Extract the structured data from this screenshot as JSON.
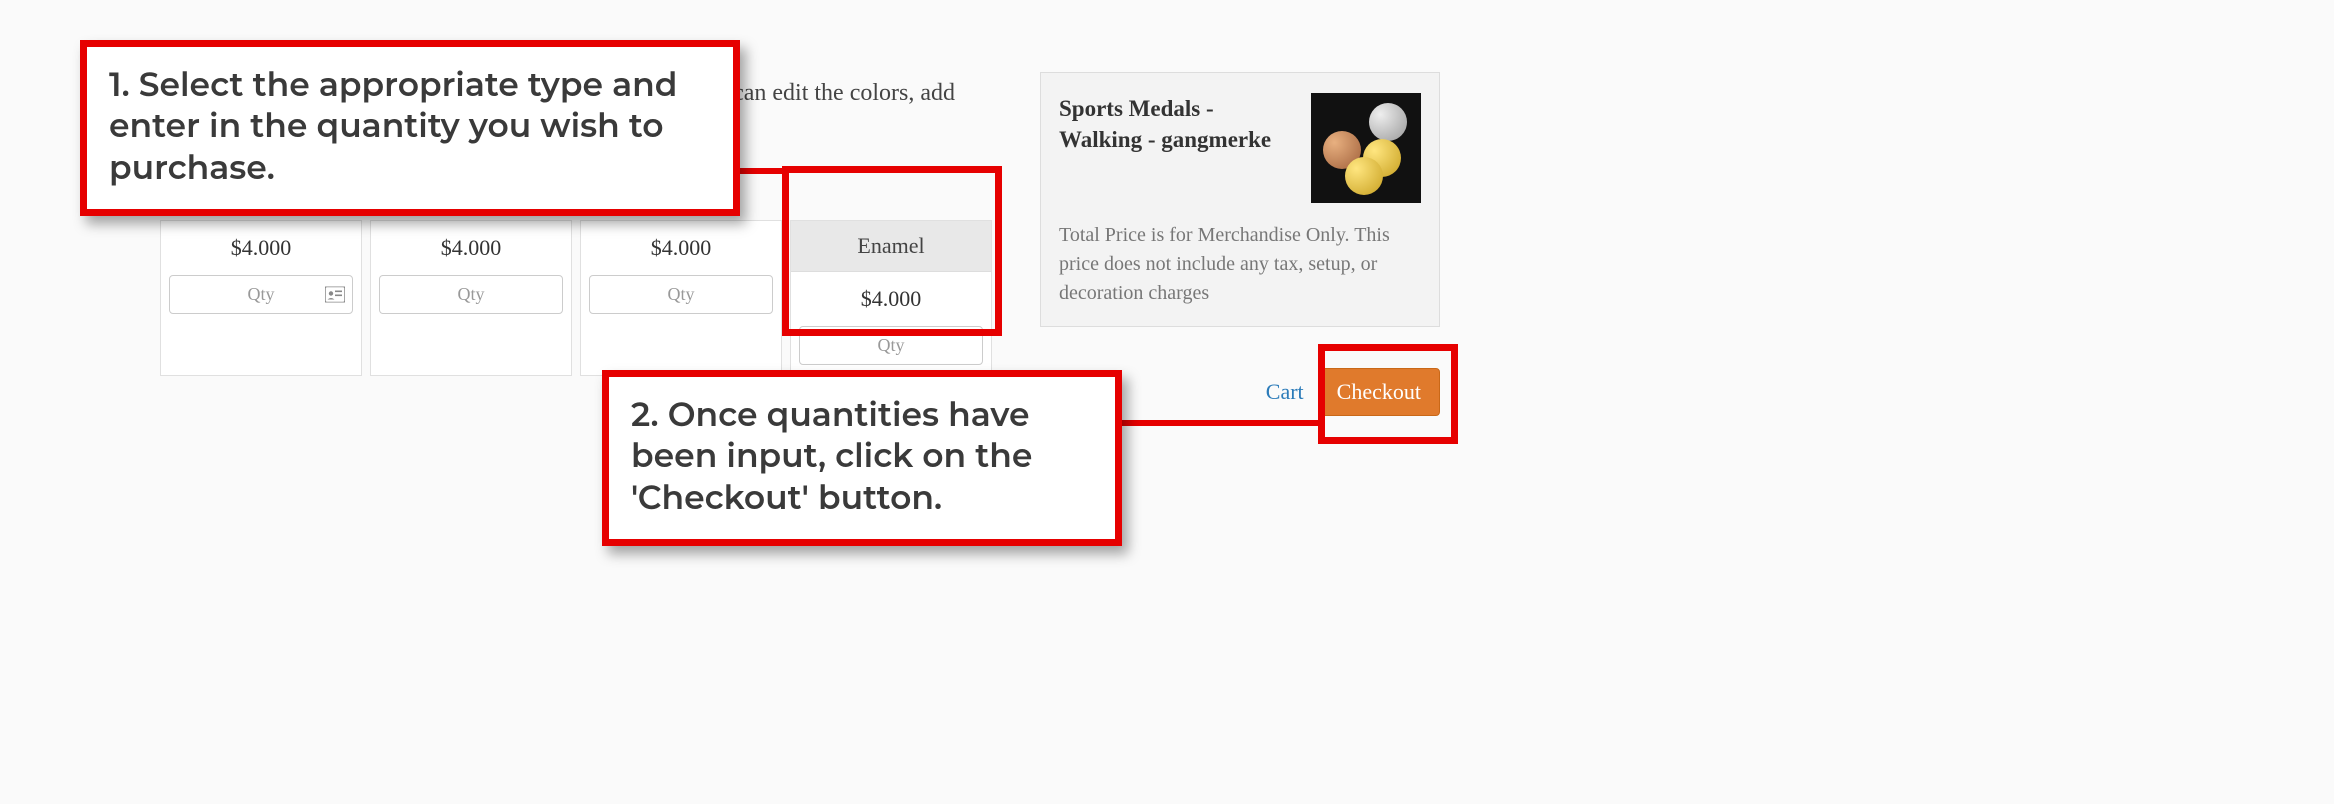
{
  "main": {
    "description_fragment": "u can edit the colors, add"
  },
  "pricing": {
    "columns": [
      {
        "header": "",
        "price": "$4.000",
        "qty_placeholder": "Qty"
      },
      {
        "header": "",
        "price": "$4.000",
        "qty_placeholder": "Qty"
      },
      {
        "header": "",
        "price": "$4.000",
        "qty_placeholder": "Qty"
      },
      {
        "header": "Enamel",
        "price": "$4.000",
        "qty_placeholder": "Qty"
      }
    ]
  },
  "sidebar": {
    "title": "Sports Medals - Walking - gangmerke",
    "disclaimer": "Total Price is for Merchandise Only. This price does not include any tax, setup, or decoration charges"
  },
  "actions": {
    "cart_link_fragment": "Cart",
    "checkout_label": "Checkout"
  },
  "callouts": {
    "step1": "1. Select the appropriate type and enter in the quantity you wish to purchase.",
    "step2": "2. Once quantities have been input, click on the 'Checkout' button."
  }
}
